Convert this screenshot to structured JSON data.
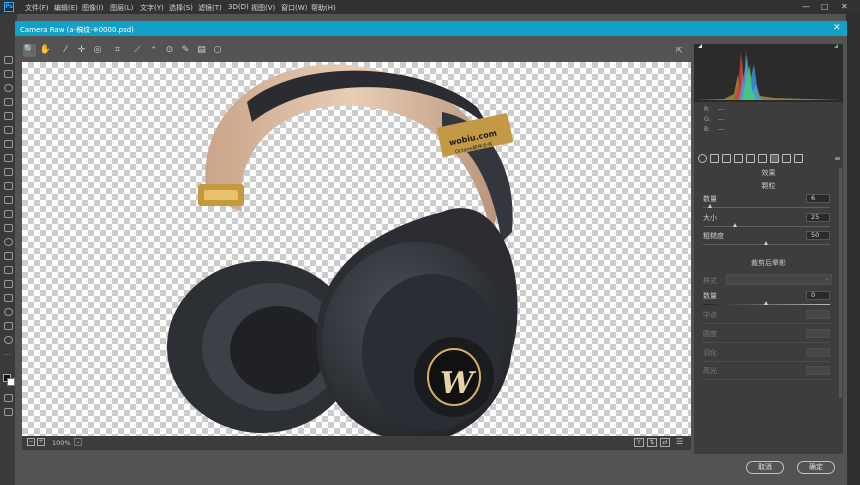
{
  "app": {
    "logo": "Ps",
    "menus": [
      "文件(F)",
      "编辑(E)",
      "图像(I)",
      "图层(L)",
      "文字(Y)",
      "选择(S)",
      "滤镜(T)",
      "3D(D)",
      "视图(V)",
      "窗口(W)",
      "帮助(H)"
    ],
    "window_controls": [
      "—",
      "□",
      "✕"
    ]
  },
  "dialog": {
    "title": "Camera Raw (a-稿纹-※0000.psd)",
    "close": "✕"
  },
  "tools": [
    {
      "name": "zoom-icon",
      "glyph": "🔍"
    },
    {
      "name": "hand-icon",
      "glyph": "✋"
    },
    {
      "name": "white-balance-icon",
      "glyph": "⁄"
    },
    {
      "name": "color-sampler-icon",
      "glyph": "✛"
    },
    {
      "name": "target-adjust-icon",
      "glyph": "◎"
    },
    {
      "name": "crop-icon",
      "glyph": "⌗"
    },
    {
      "name": "straighten-icon",
      "glyph": "⟋"
    },
    {
      "name": "spot-removal-icon",
      "glyph": "⁺"
    },
    {
      "name": "redeye-icon",
      "glyph": "⊙"
    },
    {
      "name": "adjust-brush-icon",
      "glyph": "✎"
    },
    {
      "name": "grad-filter-icon",
      "glyph": "▤"
    },
    {
      "name": "radial-filter-icon",
      "glyph": "○"
    }
  ],
  "canvas": {
    "logo_text": "wobiu.com",
    "logo_sub": "Octane软件全书",
    "cup_letter": "W"
  },
  "bottom": {
    "zoom": "100%"
  },
  "histogram": {
    "r": "R:",
    "g": "G:",
    "b": "B:",
    "dash": "---"
  },
  "effects": {
    "title": "效果",
    "grain": {
      "title": "颗粒",
      "amount_label": "数量",
      "amount": "6",
      "size_label": "大小",
      "size": "25",
      "rough_label": "粗糙度",
      "rough": "50"
    },
    "vignette": {
      "title": "裁剪后晕影",
      "style_label": "样式",
      "amount_label": "数量",
      "amount": "0",
      "midpoint_label": "中点",
      "roundness_label": "圆度",
      "feather_label": "羽化",
      "highlights_label": "高光"
    }
  },
  "buttons": {
    "cancel": "取消",
    "ok": "确定"
  }
}
